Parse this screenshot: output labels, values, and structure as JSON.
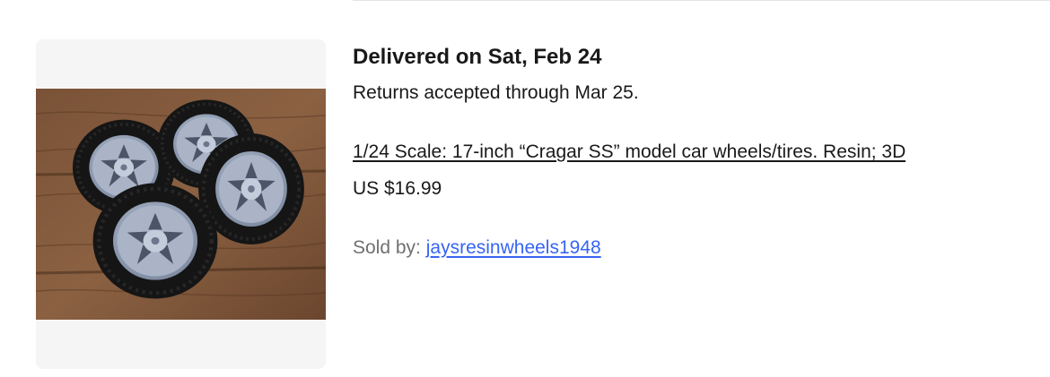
{
  "order": {
    "delivery_status": "Delivered on Sat, Feb 24",
    "returns_text": "Returns accepted through Mar 25.",
    "item": {
      "title": "1/24 Scale: 17-inch “Cragar SS” model car wheels/tires. Resin; 3D",
      "price": "US $16.99",
      "image_icon": "product-photo-wheels-tires"
    },
    "seller": {
      "label": "Sold by:",
      "name": "jaysresinwheels1948"
    }
  },
  "colors": {
    "link": "#3665f3",
    "muted_text": "#707070",
    "primary_text": "#191919",
    "image_frame_bg": "#f5f5f5"
  }
}
